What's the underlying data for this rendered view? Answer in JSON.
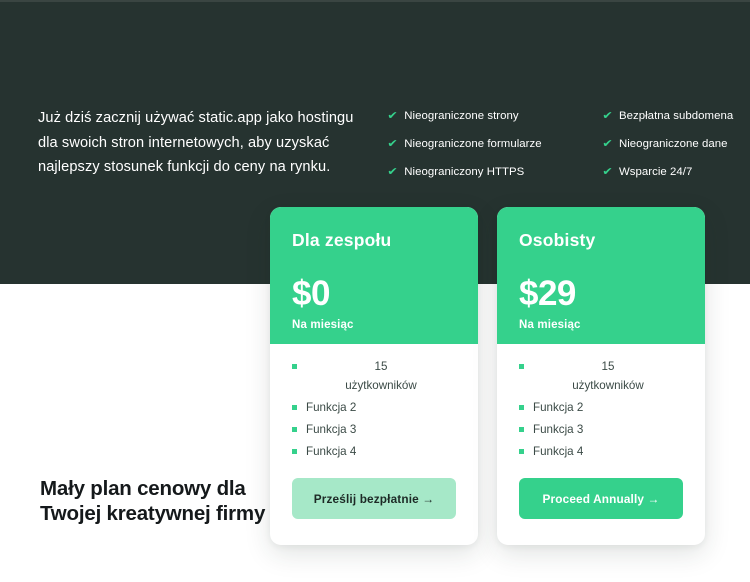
{
  "theme": {
    "dark_bg": "#263330",
    "accent_green": "#35d18c",
    "accent_soft": "#a6e8c8",
    "text_light": "#ffffff",
    "text_dark": "#15191b"
  },
  "hero": {
    "intro": "Już dziś zacznij używać static.app jako hostingu dla swoich stron internetowych, aby uzyskać najlepszy stosunek funkcji do ceny na rynku.",
    "check_icon": "✔",
    "feature_columns": [
      {
        "items": [
          "Nieograniczone strony",
          "Nieograniczone formularze",
          "Nieograniczony HTTPS"
        ]
      },
      {
        "items": [
          "Bezpłatna subdomena",
          "Nieograniczone dane",
          "Wsparcie 24/7"
        ]
      }
    ]
  },
  "pricing": {
    "cards": [
      {
        "title": "Dla zespołu",
        "price": "$0",
        "period": "Na miesiąc",
        "features": [
          "15 użytkowników",
          "Funkcja 2",
          "Funkcja 3",
          "Funkcja 4"
        ],
        "cta_label": "Prześlij bezpłatnie →"
      },
      {
        "title": "Osobisty",
        "price": "$29",
        "period": "Na miesiąc",
        "features": [
          "15 użytkowników",
          "Funkcja 2",
          "Funkcja 3",
          "Funkcja 4"
        ],
        "cta_label": "Proceed Annually →"
      }
    ]
  },
  "bottom": {
    "headline": "Mały plan cenowy dla Twojej kreatywnej firmy"
  }
}
